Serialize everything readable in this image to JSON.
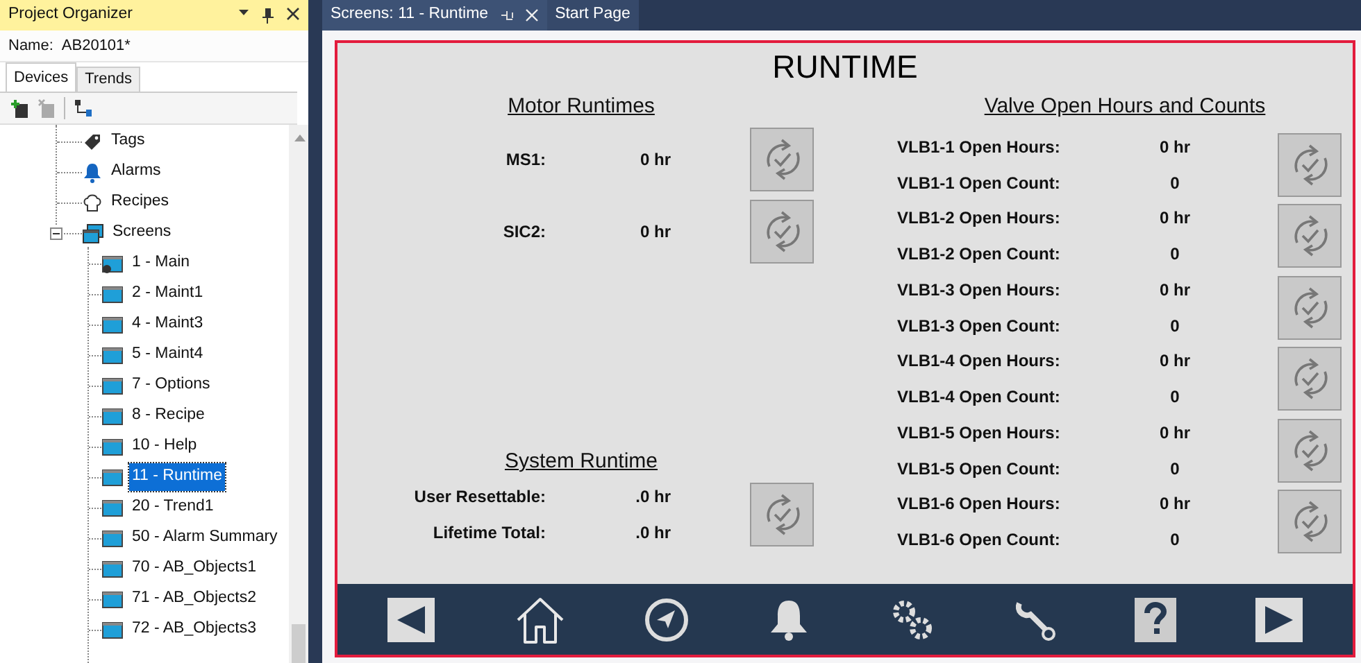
{
  "organizer": {
    "title": "Project Organizer",
    "name_label": "Name:",
    "name_value": "AB20101*",
    "tabs": [
      {
        "label": "Devices",
        "selected": true
      },
      {
        "label": "Trends",
        "selected": false
      }
    ],
    "tree": [
      {
        "label": "Tags",
        "kind": "tag",
        "selected": false
      },
      {
        "label": "Alarms",
        "kind": "alarm",
        "selected": false
      },
      {
        "label": "Recipes",
        "kind": "recipe",
        "selected": false
      },
      {
        "label": "Screens",
        "kind": "screens",
        "selected": false,
        "expanded": true,
        "children": [
          {
            "label": "1 - Main",
            "kind": "main-screen",
            "selected": false
          },
          {
            "label": "2 - Maint1",
            "kind": "screen",
            "selected": false
          },
          {
            "label": "4 - Maint3",
            "kind": "screen",
            "selected": false
          },
          {
            "label": "5 - Maint4",
            "kind": "screen",
            "selected": false
          },
          {
            "label": "7 - Options",
            "kind": "screen",
            "selected": false
          },
          {
            "label": "8 - Recipe",
            "kind": "screen",
            "selected": false
          },
          {
            "label": "10 - Help",
            "kind": "screen",
            "selected": false
          },
          {
            "label": "11 - Runtime",
            "kind": "screen",
            "selected": true
          },
          {
            "label": "20 - Trend1",
            "kind": "screen",
            "selected": false
          },
          {
            "label": "50 - Alarm Summary",
            "kind": "screen",
            "selected": false
          },
          {
            "label": "70 - AB_Objects1",
            "kind": "screen",
            "selected": false
          },
          {
            "label": "71 - AB_Objects2",
            "kind": "screen",
            "selected": false
          },
          {
            "label": "72 - AB_Objects3",
            "kind": "screen",
            "selected": false
          }
        ]
      }
    ]
  },
  "document_tabs": [
    {
      "label": "Screens: 11 - Runtime",
      "selected": true
    },
    {
      "label": "Start Page",
      "selected": false
    }
  ],
  "runtime_screen": {
    "title": "RUNTIME",
    "motor_section": {
      "heading": "Motor Runtimes",
      "rows": [
        {
          "label": "MS1:",
          "value": "0 hr"
        },
        {
          "label": "SIC2:",
          "value": "0 hr"
        }
      ]
    },
    "system_section": {
      "heading": "System Runtime",
      "rows": [
        {
          "label": "User Resettable:",
          "value": ".0 hr"
        },
        {
          "label": "Lifetime Total:",
          "value": ".0 hr"
        }
      ]
    },
    "valve_section": {
      "heading": "Valve Open Hours and Counts",
      "valves": [
        {
          "hours_label": "VLB1-1 Open Hours:",
          "hours_value": "0 hr",
          "count_label": "VLB1-1 Open Count:",
          "count_value": "0"
        },
        {
          "hours_label": "VLB1-2 Open Hours:",
          "hours_value": "0 hr",
          "count_label": "VLB1-2 Open Count:",
          "count_value": "0"
        },
        {
          "hours_label": "VLB1-3 Open Hours:",
          "hours_value": "0 hr",
          "count_label": "VLB1-3 Open Count:",
          "count_value": "0"
        },
        {
          "hours_label": "VLB1-4 Open Hours:",
          "hours_value": "0 hr",
          "count_label": "VLB1-4 Open Count:",
          "count_value": "0"
        },
        {
          "hours_label": "VLB1-5 Open Hours:",
          "hours_value": "0 hr",
          "count_label": "VLB1-5 Open Count:",
          "count_value": "0"
        },
        {
          "hours_label": "VLB1-6 Open Hours:",
          "hours_value": "0 hr",
          "count_label": "VLB1-6 Open Count:",
          "count_value": "0"
        }
      ]
    }
  }
}
